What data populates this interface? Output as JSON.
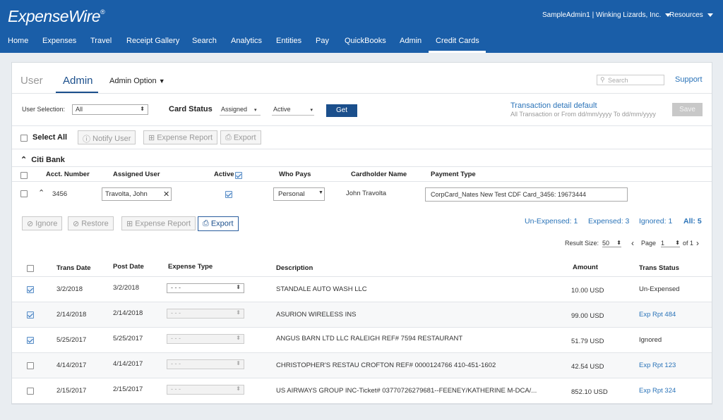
{
  "header": {
    "logo": "ExpenseWire",
    "logo_mark": "®",
    "account": "SampleAdmin1 | Winking Lizards, Inc.",
    "resources": "Resources",
    "nav": [
      "Home",
      "Expenses",
      "Travel",
      "Receipt Gallery",
      "Search",
      "Analytics",
      "Entities",
      "Pay",
      "QuickBooks",
      "Admin",
      "Credit Cards"
    ],
    "active_nav": "Credit Cards"
  },
  "tabs": {
    "user": "User",
    "admin": "Admin",
    "admin_option": "Admin Option"
  },
  "search": {
    "placeholder": "Search"
  },
  "support": "Support",
  "filters": {
    "user_selection_label": "User Selection:",
    "user_selection_value": "All",
    "card_status_label": "Card Status",
    "card_status_value": "Assigned",
    "active_value": "Active",
    "get": "Get",
    "txn_default_title": "Transaction detail default",
    "txn_default_hint": "All Transaction or From dd/mm/yyyy To dd/mm/yyyy",
    "save": "Save"
  },
  "bulk": {
    "select_all": "Select All",
    "notify_user": "Notify User",
    "expense_report": "Expense Report",
    "export": "Export"
  },
  "bank": {
    "name": "Citi Bank",
    "columns": {
      "acct": "Acct. Number",
      "user": "Assigned User",
      "active": "Active",
      "who_pays": "Who Pays",
      "cardholder": "Cardholder Name",
      "payment_type": "Payment Type"
    },
    "card": {
      "acct": "3456",
      "user": "Travolta, John",
      "who_pays": "Personal",
      "cardholder": "John Travolta",
      "payment_type": "CorpCard_Nates New Test CDF Card_3456: 19673444"
    }
  },
  "txn_actions": {
    "ignore": "Ignore",
    "restore": "Restore",
    "expense_report": "Expense Report",
    "export": "Export"
  },
  "counts": {
    "unexpensed": "Un-Expensed: 1",
    "expensed": "Expensed: 3",
    "ignored": "Ignored: 1",
    "all": "All: 5"
  },
  "paging": {
    "result_size_label": "Result Size:",
    "result_size": "50",
    "page_label": "Page",
    "page": "1",
    "of": "of 1"
  },
  "txn_columns": {
    "trans_date": "Trans Date",
    "post_date": "Post Date",
    "expense_type": "Expense Type",
    "description": "Description",
    "amount": "Amount",
    "status": "Trans Status"
  },
  "transactions": [
    {
      "checked": true,
      "trans_date": "3/2/2018",
      "post_date": "3/2/2018",
      "expense_type": "- - -",
      "enabled": true,
      "description": "STANDALE AUTO WASH LLC",
      "amount": "10.00 USD",
      "status": "Un-Expensed",
      "status_link": false
    },
    {
      "checked": true,
      "trans_date": "2/14/2018",
      "post_date": "2/14/2018",
      "expense_type": "- - -",
      "enabled": false,
      "description": "ASURION WIRELESS INS",
      "amount": "99.00 USD",
      "status": "Exp Rpt 484",
      "status_link": true
    },
    {
      "checked": true,
      "trans_date": "5/25/2017",
      "post_date": "5/25/2017",
      "expense_type": "- - -",
      "enabled": false,
      "description": "ANGUS BARN LTD LLC RALEIGH REF# 7594 RESTAURANT",
      "amount": "51.79 USD",
      "status": "Ignored",
      "status_link": false
    },
    {
      "checked": false,
      "trans_date": "4/14/2017",
      "post_date": "4/14/2017",
      "expense_type": "- - -",
      "enabled": false,
      "description": "CHRISTOPHER'S RESTAU CROFTON REF# 0000124766 410-451-1602",
      "amount": "42.54 USD",
      "status": "Exp Rpt 123",
      "status_link": true
    },
    {
      "checked": false,
      "trans_date": "2/15/2017",
      "post_date": "2/15/2017",
      "expense_type": "- - -",
      "enabled": false,
      "description": "US AIRWAYS GROUP INC-Ticket# 03770726279681--FEENEY/KATHERINE M-DCA/...",
      "amount": "852.10 USD",
      "status": "Exp Rpt 324",
      "status_link": true
    }
  ]
}
